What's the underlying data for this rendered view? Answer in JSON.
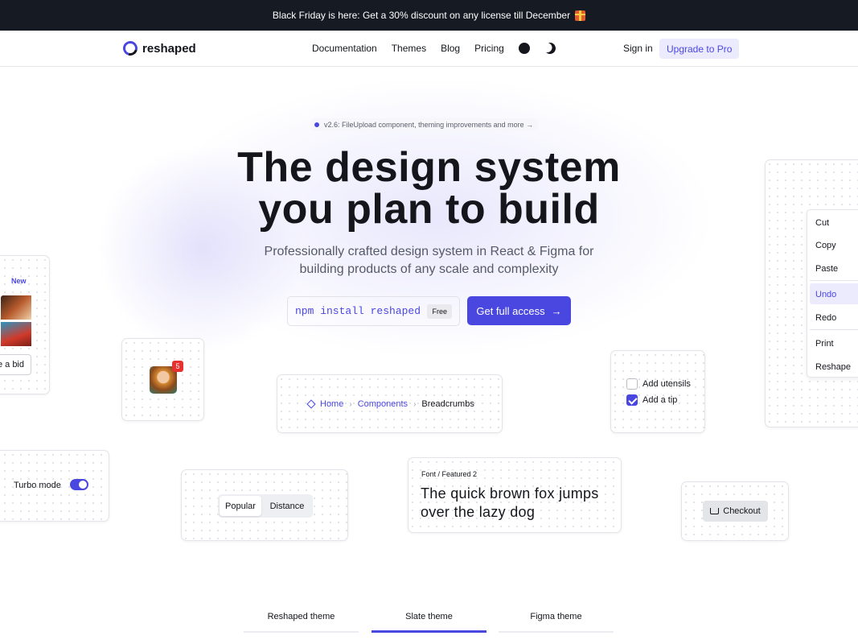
{
  "banner": {
    "text": "Black Friday is here: Get a 30% discount on any license till December"
  },
  "nav": {
    "logo": "reshaped",
    "links": [
      "Documentation",
      "Themes",
      "Blog",
      "Pricing"
    ],
    "sign_in": "Sign in",
    "upgrade": "Upgrade to Pro"
  },
  "version": {
    "text": "v2.6: FileUpload component, theming improvements and more →"
  },
  "hero": {
    "title_line1": "The design system",
    "title_line2": "you plan to build",
    "subtitle_line1": "Professionally crafted design system in React & Figma for",
    "subtitle_line2": "building products of any scale and complexity"
  },
  "cta": {
    "command": "npm install reshaped",
    "free_badge": "Free",
    "access_button": "Get full access",
    "arrow": "→"
  },
  "showcase": {
    "new_badge": "New",
    "bid_button": "e a bid",
    "notification_count": "5",
    "breadcrumbs": {
      "home": "Home",
      "components": "Components",
      "current": "Breadcrumbs",
      "separator": "›"
    },
    "checkboxes": [
      {
        "label": "Add utensils",
        "checked": false
      },
      {
        "label": "Add a tip",
        "checked": true
      }
    ],
    "menu": [
      "Cut",
      "Copy",
      "Paste",
      "Undo",
      "Redo",
      "Print",
      "Reshape"
    ],
    "menu_active": "Undo",
    "turbo_label": "Turbo mode",
    "turbo_on": true,
    "segments": [
      "Popular",
      "Distance"
    ],
    "font_tag": "Font / Featured 2",
    "font_sample": "The quick brown fox jumps over the lazy dog",
    "checkout": "Checkout"
  },
  "theme_tabs": [
    {
      "label": "Reshaped theme",
      "active": false
    },
    {
      "label": "Slate theme",
      "active": true
    },
    {
      "label": "Figma theme",
      "active": false
    }
  ],
  "colors": {
    "accent": "#4a47e0",
    "banner_bg": "#161a22",
    "badge_red": "#e5322e"
  }
}
